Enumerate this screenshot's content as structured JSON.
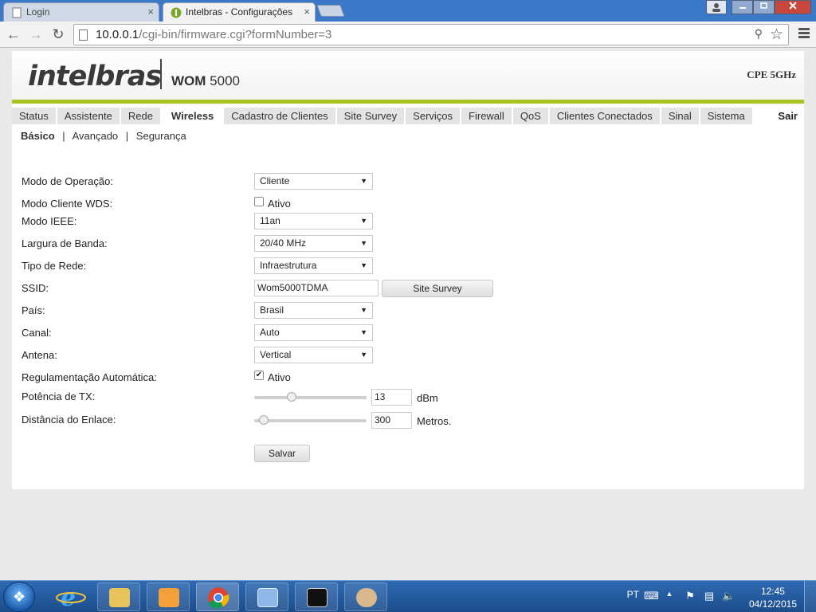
{
  "browser": {
    "tabs": [
      {
        "title": "Login",
        "active": false
      },
      {
        "title": "Intelbras - Configurações",
        "active": true
      }
    ],
    "url": "10.0.0.1/cgi-bin/firmware.cgi?formNumber=3",
    "url_host": "10.0.0.1",
    "url_path": "/cgi-bin/firmware.cgi?formNumber=3",
    "close_glyph": "×"
  },
  "header": {
    "logo": "intelbras",
    "product_brand": "WOM",
    "product_num": "5000",
    "model": "CPE 5GHz"
  },
  "nav": {
    "tabs": [
      "Status",
      "Assistente",
      "Rede",
      "Wireless",
      "Cadastro de Clientes",
      "Site Survey",
      "Serviços",
      "Firewall",
      "QoS",
      "Clientes Conectados",
      "Sinal",
      "Sistema"
    ],
    "selected": "Wireless",
    "logout": "Sair"
  },
  "subnav": {
    "items": [
      "Básico",
      "Avançado",
      "Segurança"
    ],
    "selected": "Básico",
    "separator": "|"
  },
  "form": {
    "modo_operacao": {
      "label": "Modo de Operação:",
      "value": "Cliente"
    },
    "modo_wds": {
      "label": "Modo Cliente WDS:",
      "checked": false,
      "option": "Ativo"
    },
    "modo_ieee": {
      "label": "Modo IEEE:",
      "value": "11an"
    },
    "largura_banda": {
      "label": "Largura de Banda:",
      "value": "20/40 MHz"
    },
    "tipo_rede": {
      "label": "Tipo de Rede:",
      "value": "Infraestrutura"
    },
    "ssid": {
      "label": "SSID:",
      "value": "Wom5000TDMA",
      "button": "Site Survey"
    },
    "pais": {
      "label": "País:",
      "value": "Brasil"
    },
    "canal": {
      "label": "Canal:",
      "value": "Auto"
    },
    "antena": {
      "label": "Antena:",
      "value": "Vertical"
    },
    "regulamentacao": {
      "label": "Regulamentação Automática:",
      "checked": true,
      "option": "Ativo"
    },
    "potencia": {
      "label": "Potência de TX:",
      "value": "13",
      "unit": "dBm",
      "slider_fraction": 0.32
    },
    "distancia": {
      "label": "Distância do Enlace:",
      "value": "300",
      "unit": "Metros.",
      "slider_fraction": 0.05
    },
    "save": "Salvar"
  },
  "taskbar": {
    "lang": "PT",
    "time": "12:45",
    "date": "04/12/2015",
    "apps": [
      "internet-explorer",
      "file-explorer",
      "media-player",
      "chrome",
      "control-panel",
      "command-prompt",
      "paint"
    ]
  },
  "colors": {
    "accent_green": "#a7c424",
    "tabstrip_blue": "#3b78c8",
    "nav_tab_bg": "#e4e4e4"
  }
}
